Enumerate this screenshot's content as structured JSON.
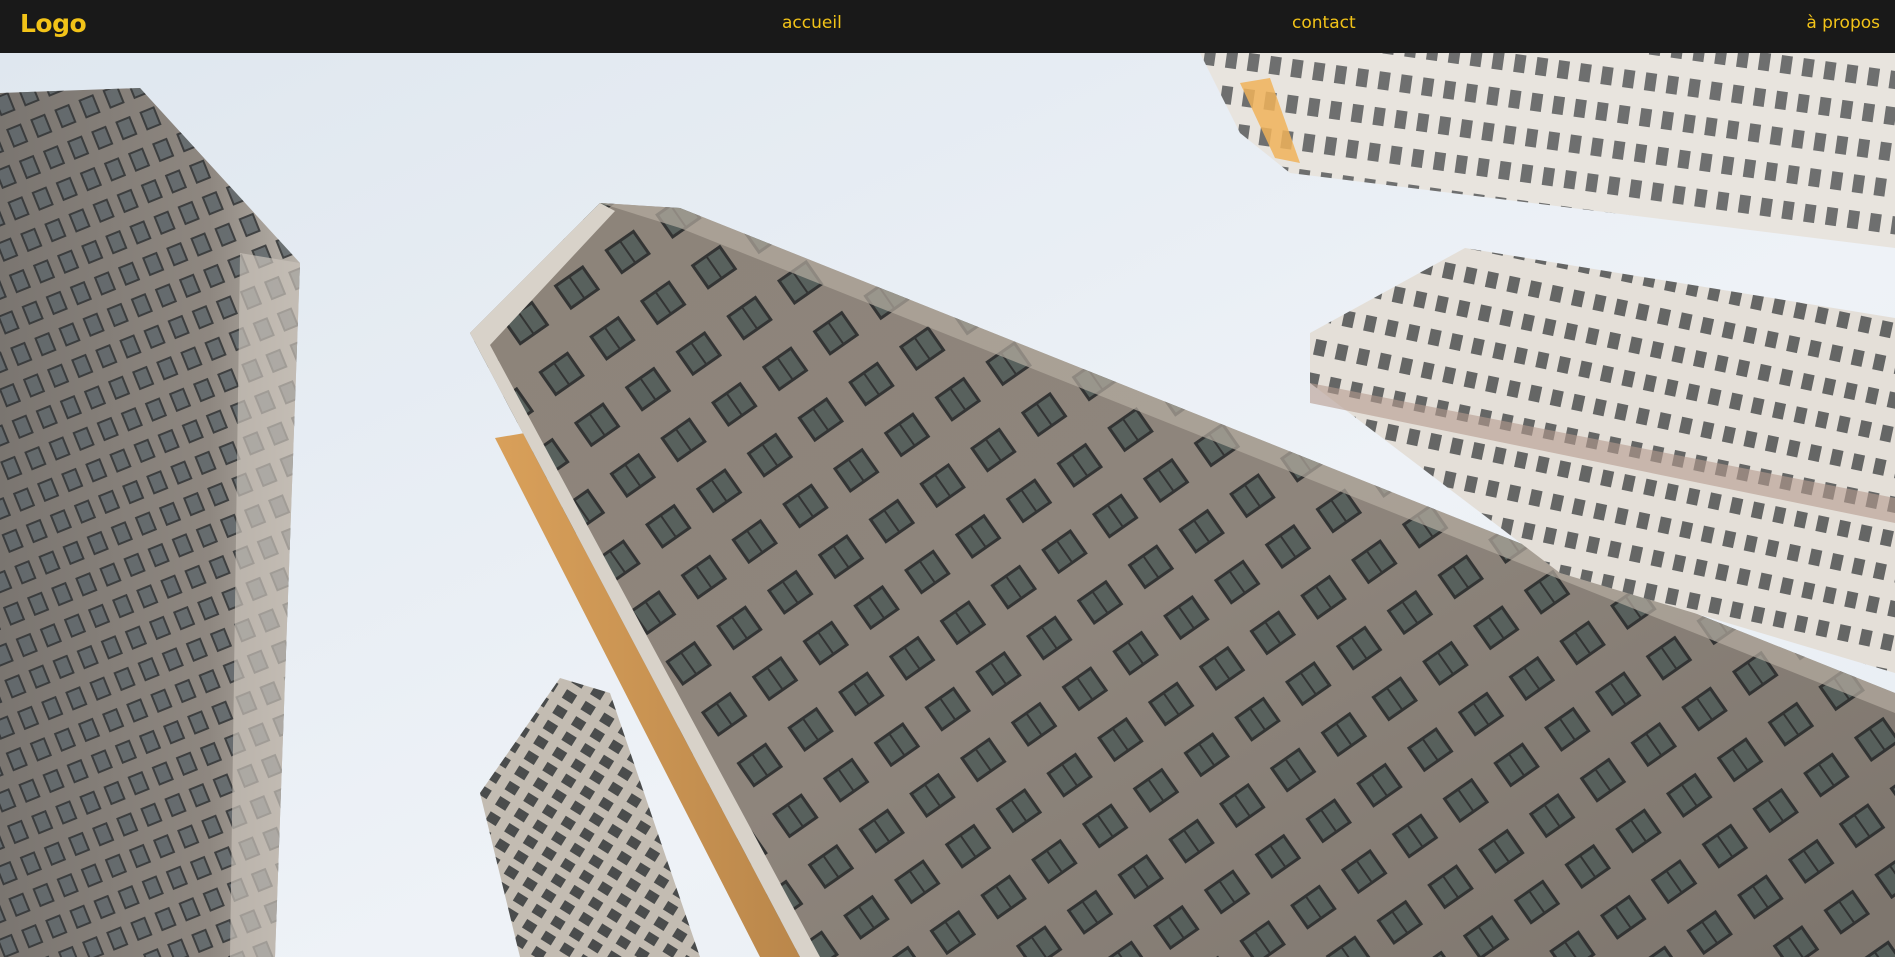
{
  "header": {
    "logo": "Logo",
    "nav": [
      {
        "label": "accueil"
      },
      {
        "label": "contact"
      },
      {
        "label": "à propos"
      }
    ]
  },
  "hero": {
    "image": "low-angle-high-rise-buildings-photo"
  },
  "colors": {
    "navbar_bg": "#191919",
    "accent": "#f2c318",
    "sky": "#e4ebf2"
  }
}
